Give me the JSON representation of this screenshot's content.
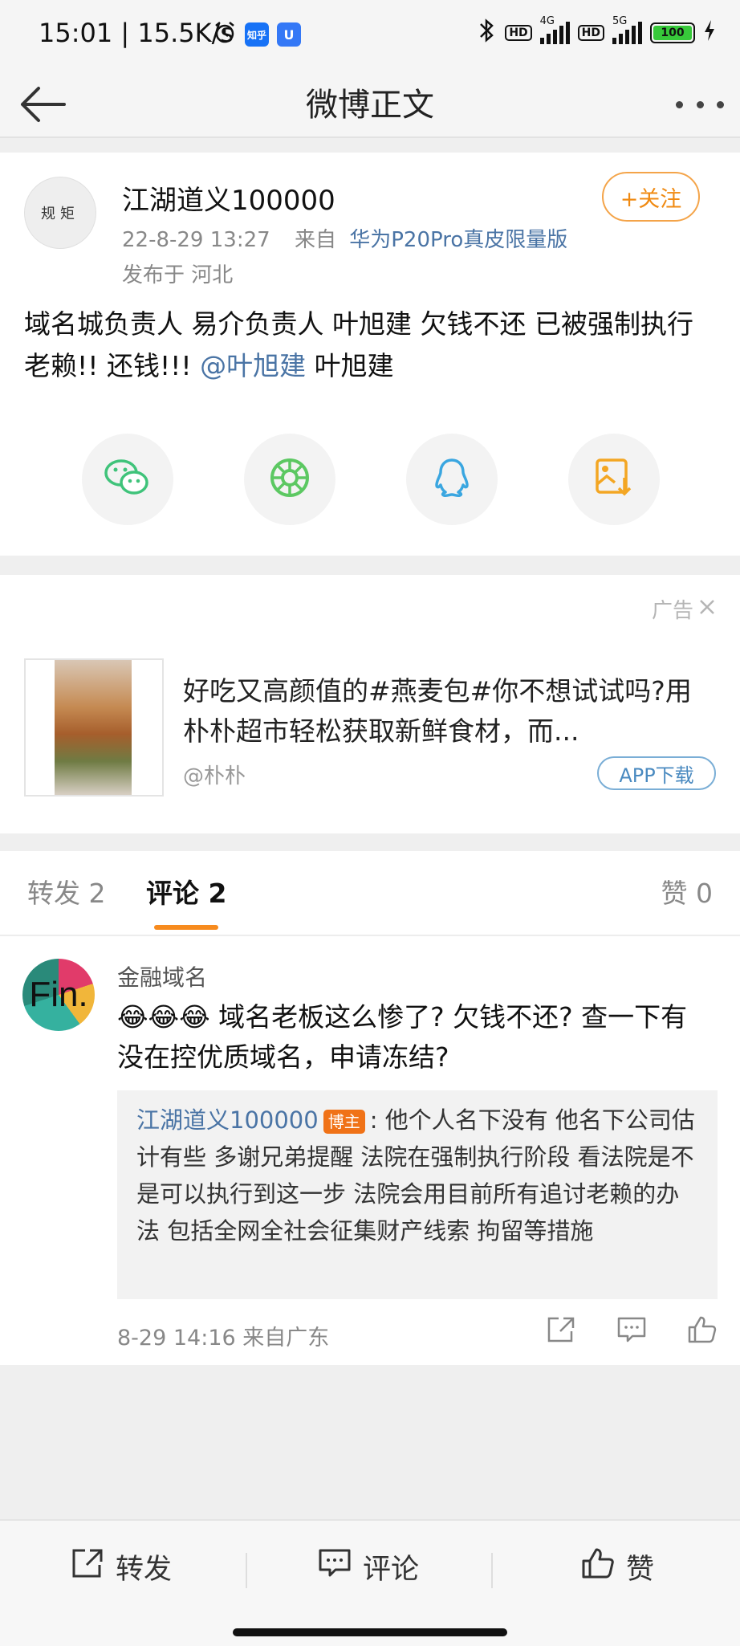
{
  "status_bar": {
    "time": "15:01 | 15.5K/s",
    "app_badge_zhihu": "知乎",
    "app_badge_u": "U",
    "net1": "4G",
    "net2": "5G",
    "hd": "HD",
    "battery": "100"
  },
  "header": {
    "title": "微博正文"
  },
  "post": {
    "avatar_text": "规矩",
    "username": "江湖道义100000",
    "timestamp": "22-8-29 13:27",
    "source_prefix": "来自",
    "source_device": "华为P20Pro真皮限量版",
    "location": "发布于 河北",
    "follow_label": "+关注",
    "text_before": "域名城负责人  易介负责人  叶旭建 欠钱不还 已被强制执行  老赖!!  还钱!!! ",
    "mention": "@叶旭建",
    "text_after": " 叶旭建",
    "share": [
      "wechat-icon",
      "moments-icon",
      "qq-icon",
      "save-image-icon"
    ]
  },
  "ad": {
    "label": "广告",
    "text": "好吃又高颜值的#燕麦包#你不想试试吗?用朴朴超市轻松获取新鲜食材，而...",
    "source": "@朴朴",
    "button": "APP下载"
  },
  "tabs": {
    "repost": "转发 2",
    "comments": "评论 2",
    "likes": "赞 0"
  },
  "comment": {
    "avatar_text": "Fin.",
    "name": "金融域名",
    "emoji": "😂😂😂",
    "text": " 域名老板这么惨了? 欠钱不还? 查一下有没在控优质域名，申请冻结?",
    "reply_name": "江湖道义100000",
    "reply_badge": "博主",
    "reply_text": ": 他个人名下没有  他名下公司估计有些  多谢兄弟提醒  法院在强制执行阶段  看法院是不是可以执行到这一步    法院会用目前所有追讨老赖的办法 包括全网全社会征集财产线索 拘留等措施",
    "meta": "8-29 14:16  来自广东"
  },
  "bottom_bar": {
    "repost": "转发",
    "comment": "评论",
    "like": "赞"
  },
  "colors": {
    "accent_orange": "#f78b1e",
    "link_blue": "#4a74a5",
    "wechat_green": "#3fc37a",
    "qq_blue": "#3aa6e0",
    "save_orange": "#f3a623"
  }
}
